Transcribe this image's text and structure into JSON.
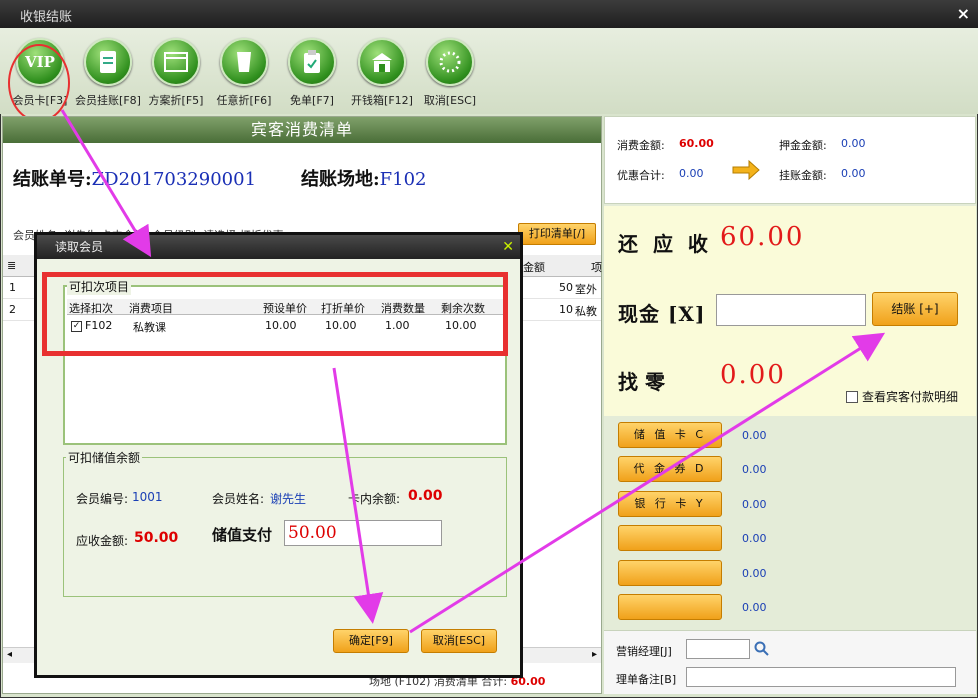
{
  "window": {
    "title": "收银结账",
    "close": "×"
  },
  "toolbar": [
    {
      "label": "会员卡[F3]",
      "icon": "VIP"
    },
    {
      "label": "会员挂账[F8]",
      "icon": "doc"
    },
    {
      "label": "方案折[F5]",
      "icon": "screen"
    },
    {
      "label": "任意折[F6]",
      "icon": "cup"
    },
    {
      "label": "免单[F7]",
      "icon": "clipboard"
    },
    {
      "label": "开钱箱[F12]",
      "icon": "box"
    },
    {
      "label": "取消[ESC]",
      "icon": "spinner"
    }
  ],
  "bill": {
    "header": "宾客消费清单",
    "no_label": "结账单号:",
    "no_value": "ZD201703290001",
    "venue_label": "结账场地:",
    "venue_value": "F102",
    "strip": "会员姓名: 谢先生      卡内余额:           会员级别: 请选择      打折优惠:",
    "print_button": "打印清单[/]",
    "cols": [
      "金额",
      "项"
    ],
    "rows": [
      {
        "idx": "1",
        "amount": "50",
        "item": "室外"
      },
      {
        "idx": "2",
        "amount": "10",
        "item": "私教"
      }
    ],
    "footer_prefix": "场地 (F102)  消费清单  合计:",
    "footer_total": "60.00"
  },
  "summary": {
    "consume_label": "消费金额:",
    "consume_value": "60.00",
    "deposit_label": "押金金额:",
    "deposit_value": "0.00",
    "discount_label": "优惠合计:",
    "discount_value": "0.00",
    "credit_label": "挂账金额:",
    "credit_value": "0.00"
  },
  "payment": {
    "due_label": "还 应 收",
    "due_value": "60.00",
    "cash_label": "现金 [X]",
    "settle_button": "结账 [+]",
    "change_label": "找    零",
    "change_value": "0.00",
    "detail_checkbox": "查看宾客付款明细",
    "methods": [
      {
        "label": "储 值 卡 C",
        "value": "0.00"
      },
      {
        "label": "代 金 券 D",
        "value": "0.00"
      },
      {
        "label": "银 行 卡 Y",
        "value": "0.00"
      },
      {
        "label": "",
        "value": "0.00"
      },
      {
        "label": "",
        "value": "0.00"
      },
      {
        "label": "",
        "value": "0.00"
      }
    ],
    "manager_label": "营销经理[J]",
    "remark_label": "理单备注[B]"
  },
  "dialog": {
    "title": "读取会员",
    "group1_label": "可扣次项目",
    "cols": [
      "选择扣次",
      "消费项目",
      "预设单价",
      "打折单价",
      "消费数量",
      "剩余次数"
    ],
    "row": {
      "code": "F102",
      "item": "私教课",
      "preset": "10.00",
      "discounted": "10.00",
      "qty": "1.00",
      "remain": "10.00"
    },
    "group2_label": "可扣储值余额",
    "member_no_label": "会员编号:",
    "member_no": "1001",
    "member_name_label": "会员姓名:",
    "member_name": "谢先生",
    "card_balance_label": "卡内余额:",
    "card_balance": "0.00",
    "receivable_label": "应收金额:",
    "receivable": "50.00",
    "stored_label": "储值支付",
    "stored_value": "50.00",
    "ok_button": "确定[F9]",
    "cancel_button": "取消[ESC]"
  }
}
